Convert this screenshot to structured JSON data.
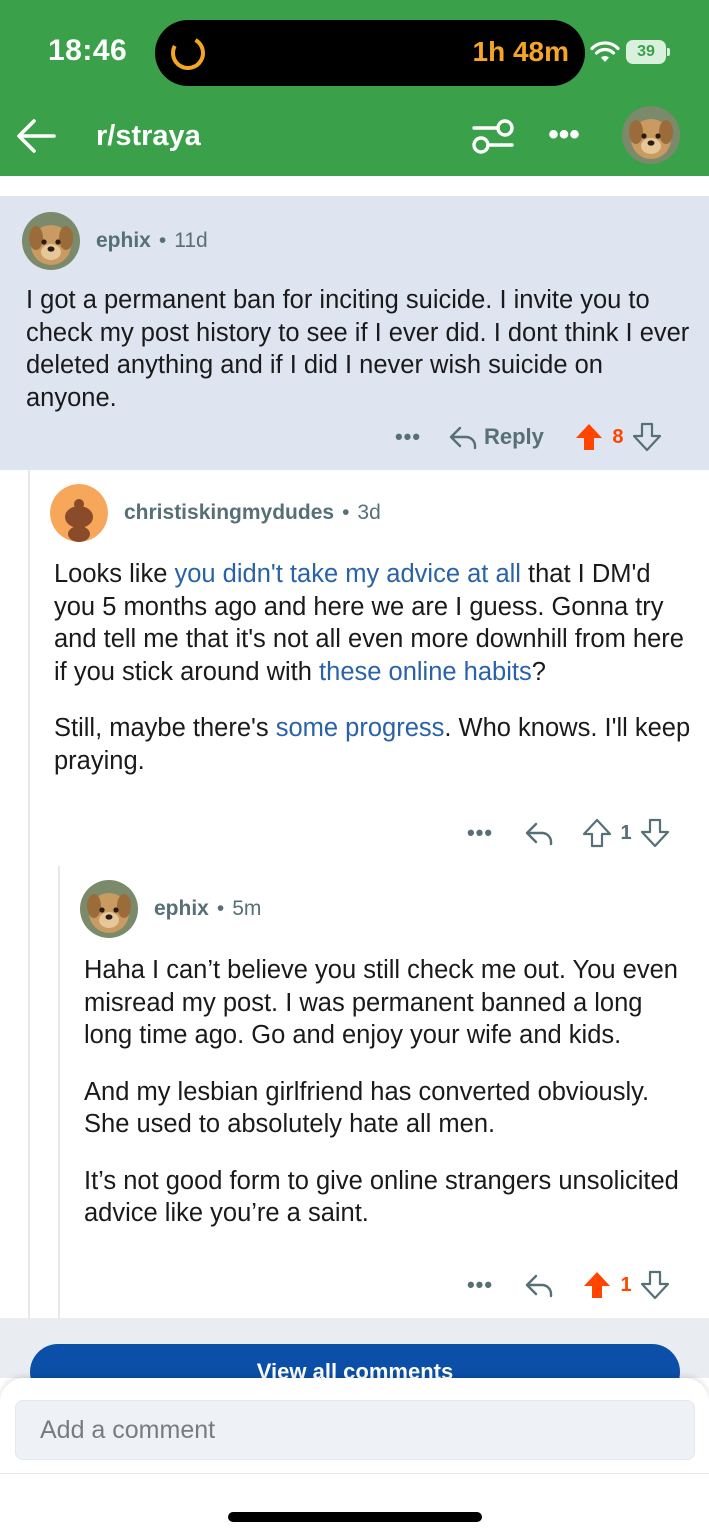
{
  "status_bar": {
    "time": "18:46",
    "activity": "1h 48m",
    "battery": "39"
  },
  "nav": {
    "title": "r/straya"
  },
  "comments": [
    {
      "user": "ephix",
      "age": "11d",
      "text": "I got a permanent ban for inciting suicide. I invite you to check my post history to see if I ever did. I dont think I ever deleted anything and if I did I never wish suicide on anyone.",
      "reply_label": "Reply",
      "score": "8"
    },
    {
      "user": "christiskingmydudes",
      "age": "3d",
      "p1": {
        "a": "Looks like ",
        "link1": "you didn't take my advice at all",
        "b": " that I DM'd you 5 months ago and here we are I guess. Gonna try and tell me that it's not all even more downhill from here if you stick around with ",
        "link2": "these online habits",
        "c": "?"
      },
      "p2": {
        "a": "Still, maybe there's ",
        "link": "some progress",
        "b": ". Who knows. I'll keep praying."
      },
      "score": "1"
    },
    {
      "user": "ephix",
      "age": "5m",
      "paragraphs": [
        "Haha I can’t believe you still check me out. You even misread my post. I was permanent banned a long long time ago. Go and enjoy your wife and kids.",
        "And my lesbian girlfriend has converted obviously. She used to absolutely hate all men.",
        "It’s not good form to give online strangers unsolicited advice like you’re a saint."
      ],
      "score": "1"
    }
  ],
  "footer": {
    "view_all": "View all comments",
    "placeholder": "Add a comment"
  },
  "colors": {
    "header": "#3aa14a",
    "upvote": "#ff4500",
    "link": "#2a62a8",
    "highlight": "#dfe4f1"
  }
}
